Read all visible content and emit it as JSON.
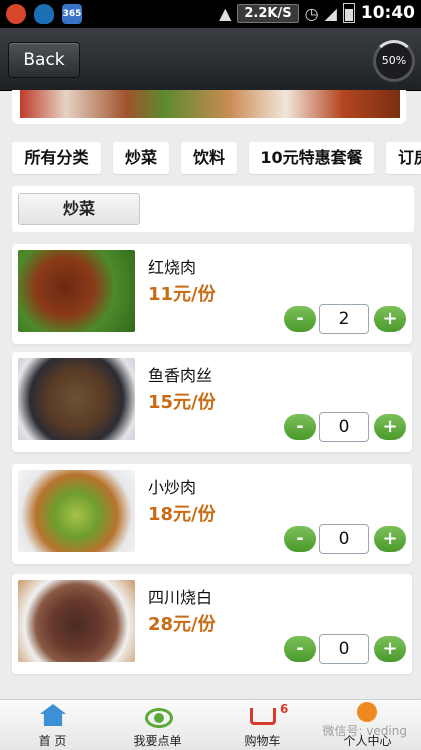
{
  "status_bar": {
    "net_speed": "2.2K/S",
    "time": "10:40",
    "app_badge": "365"
  },
  "header": {
    "back_label": "Back",
    "progress": "50%"
  },
  "categories": [
    "所有分类",
    "炒菜",
    "饮料",
    "10元特惠套餐",
    "订房"
  ],
  "subcategory": "炒菜",
  "dishes": [
    {
      "name": "红烧肉",
      "price": "11元/份",
      "qty": "2"
    },
    {
      "name": "鱼香肉丝",
      "price": "15元/份",
      "qty": "0"
    },
    {
      "name": "小炒肉",
      "price": "18元/份",
      "qty": "0"
    },
    {
      "name": "四川烧白",
      "price": "28元/份",
      "qty": "0"
    }
  ],
  "buttons": {
    "minus": "-",
    "plus": "+"
  },
  "bottom_nav": [
    {
      "label": "首 页"
    },
    {
      "label": "我要点单"
    },
    {
      "label": "购物车",
      "badge": "6"
    },
    {
      "label": "个人中心"
    }
  ],
  "watermark": "微信号: veding"
}
